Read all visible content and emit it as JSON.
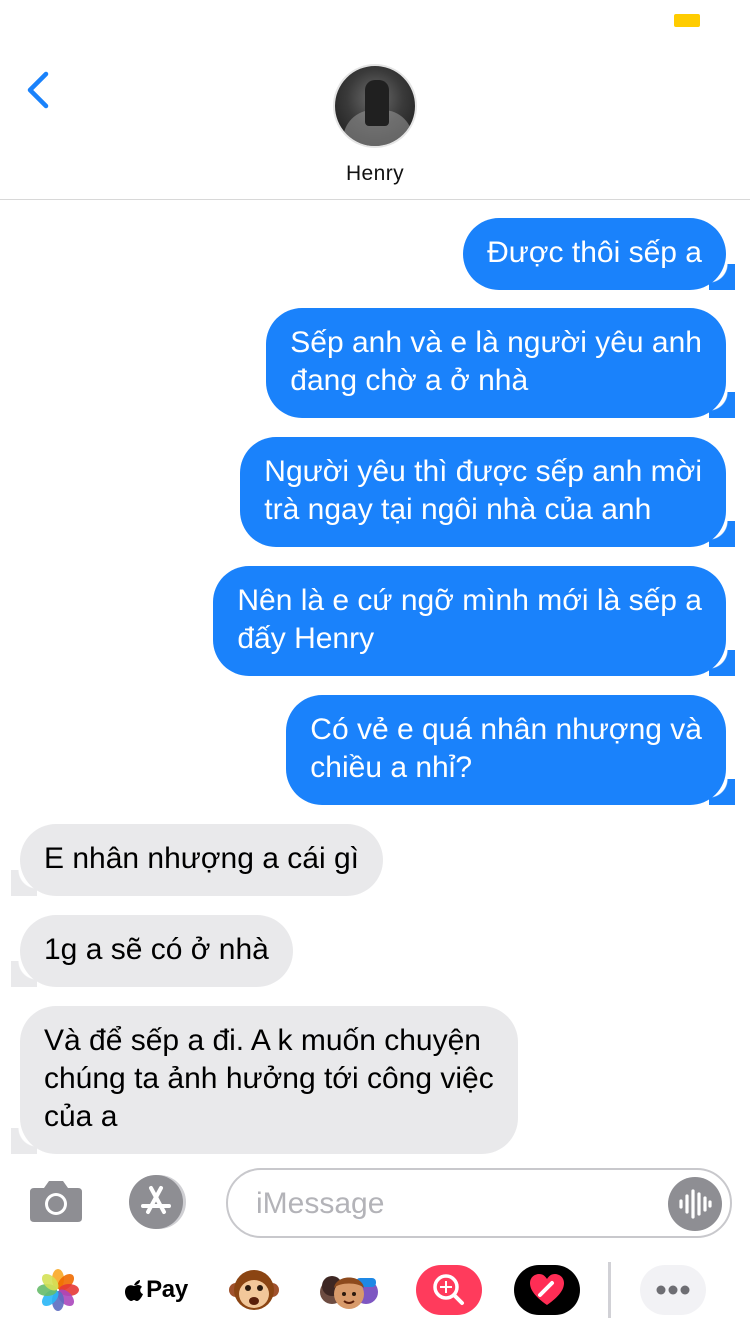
{
  "status_bar": {
    "battery_color": "#ffcc00"
  },
  "header": {
    "back_icon": "chevron-left-icon",
    "contact_name": "Henry"
  },
  "messages": [
    {
      "from": "me",
      "text": "Được thôi sếp a"
    },
    {
      "from": "me",
      "text": "Sếp anh và e là người yêu anh\nđang chờ a ở nhà"
    },
    {
      "from": "me",
      "text": "Người yêu thì được sếp anh mời\ntrà ngay tại ngôi nhà của anh"
    },
    {
      "from": "me",
      "text": "Nên là e cứ ngỡ mình mới là sếp a\nđấy Henry"
    },
    {
      "from": "me",
      "text": "Có vẻ e quá nhân nhượng và\nchiều a nhỉ?"
    },
    {
      "from": "them",
      "text": "E nhân nhượng a cái gì"
    },
    {
      "from": "them",
      "text": "1g a sẽ có ở nhà"
    },
    {
      "from": "them",
      "text": "Và để sếp a đi. A k muốn chuyện\nchúng ta ảnh hưởng tới công việc\ncủa a"
    }
  ],
  "input": {
    "placeholder": "iMessage"
  },
  "app_drawer": {
    "apps": [
      "photos-icon",
      "apple-pay-icon",
      "animoji-monkey-icon",
      "memoji-icon",
      "image-search-icon",
      "digital-touch-icon",
      "more-icon"
    ],
    "apple_pay_label": "Pay"
  },
  "colors": {
    "sent_bubble": "#1a82fb",
    "received_bubble": "#e9e9eb",
    "accent": "#1a82fb"
  }
}
